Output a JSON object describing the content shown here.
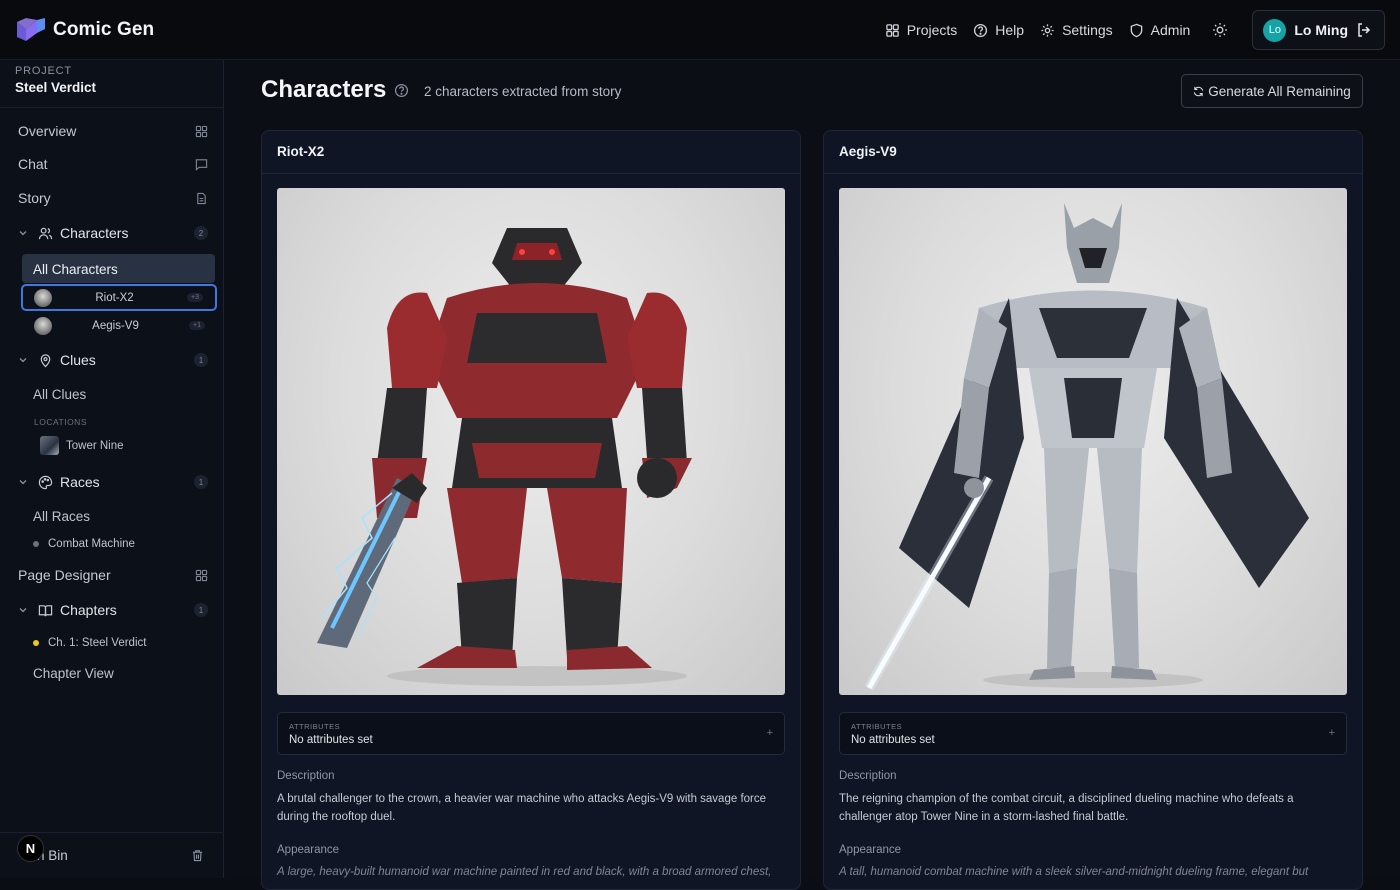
{
  "app": {
    "name": "Comic Gen"
  },
  "topnav": {
    "items": [
      {
        "label": "Projects",
        "icon": "grid-icon"
      },
      {
        "label": "Help",
        "icon": "help-circle-icon"
      },
      {
        "label": "Settings",
        "icon": "gear-icon"
      },
      {
        "label": "Admin",
        "icon": "shield-icon"
      }
    ],
    "user": {
      "initials": "Lo",
      "name": "Lo Ming"
    }
  },
  "sidebar": {
    "project_label": "PROJECT",
    "project_name": "Steel Verdict",
    "overview": "Overview",
    "chat": "Chat",
    "story": "Story",
    "characters": {
      "label": "Characters",
      "count": "2",
      "all": "All Characters",
      "items": [
        {
          "name": "Riot-X2",
          "count": "+3"
        },
        {
          "name": "Aegis-V9",
          "count": "+1"
        }
      ]
    },
    "clues": {
      "label": "Clues",
      "count": "1",
      "all": "All Clues",
      "locations_label": "LOCATIONS",
      "location": "Tower Nine"
    },
    "races": {
      "label": "Races",
      "count": "1",
      "all": "All Races",
      "item": "Combat Machine"
    },
    "page_designer": "Page Designer",
    "chapters": {
      "label": "Chapters",
      "count": "1",
      "item": "Ch. 1: Steel Verdict",
      "view": "Chapter View"
    },
    "bin_label": "n Bin",
    "n_badge": "N"
  },
  "main": {
    "title": "Characters",
    "subtitle": "2 characters extracted from story",
    "generate_button": "Generate All Remaining",
    "cards": [
      {
        "name": "Riot-X2",
        "attributes_label": "ATTRIBUTES",
        "attributes_value": "No attributes set",
        "description_label": "Description",
        "description": "A brutal challenger to the crown, a heavier war machine who attacks Aegis-V9 with savage force during the rooftop duel.",
        "appearance_label": "Appearance",
        "appearance": "A large, heavy-built humanoid war machine painted in red and black, with a broad armored chest,"
      },
      {
        "name": "Aegis-V9",
        "attributes_label": "ATTRIBUTES",
        "attributes_value": "No attributes set",
        "description_label": "Description",
        "description": "The reigning champion of the combat circuit, a disciplined dueling machine who defeats a challenger atop Tower Nine in a storm-lashed final battle.",
        "appearance_label": "Appearance",
        "appearance": "A tall, humanoid combat machine with a sleek silver-and-midnight dueling frame, elegant but"
      }
    ]
  },
  "colors": {
    "accent": "#3f78e0",
    "avatar": "#16a3a6",
    "chapter_dot": "#f5c518",
    "race_dot": "#6b7280"
  }
}
